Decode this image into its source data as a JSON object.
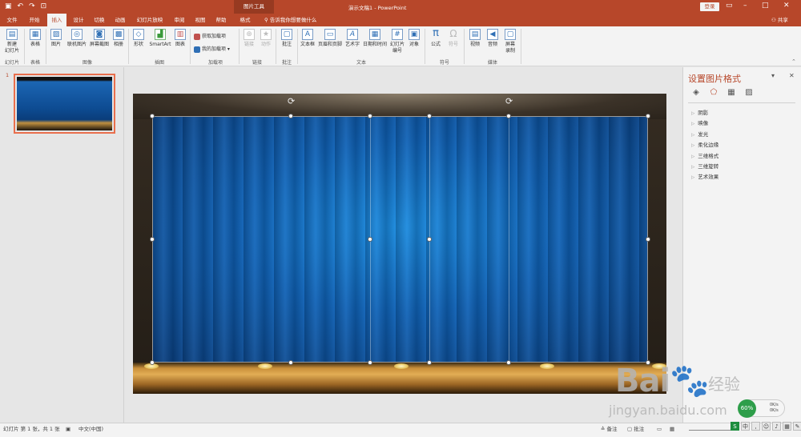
{
  "titlebar": {
    "context_tools": "图片工具",
    "doc_title": "演示文稿1 - PowerPoint",
    "login": "登录",
    "qat": [
      "save-icon",
      "undo-icon",
      "redo-icon",
      "present-icon"
    ]
  },
  "tabs": {
    "items": [
      "文件",
      "开始",
      "插入",
      "设计",
      "切换",
      "动画",
      "幻灯片放映",
      "审阅",
      "视图",
      "帮助",
      "格式"
    ],
    "active": "插入",
    "tell_me": "告诉我你想要做什么",
    "share": "共享"
  },
  "ribbon": {
    "new_slide": "新建\n幻灯片",
    "table": "表格",
    "picture": "图片",
    "online_picture": "联机图片",
    "screenshot": "屏幕截图",
    "album": "相册",
    "shapes": "形状",
    "smartart": "SmartArt",
    "chart": "图表",
    "get_addins": "获取加载项",
    "my_addins": "我的加载项",
    "link": "链接",
    "action": "动作",
    "comment": "批注",
    "textbox": "文本框",
    "header_footer": "页眉和页脚",
    "wordart": "艺术字",
    "datetime": "日期和时间",
    "slide_number": "幻灯片\n编号",
    "object": "对象",
    "equation": "公式",
    "symbol": "符号",
    "video": "视频",
    "audio": "音频",
    "screen_record": "屏幕\n录制",
    "groups": {
      "slides": "幻灯片",
      "tables": "表格",
      "images": "图像",
      "illustrations": "插图",
      "addins": "加载项",
      "links": "链接",
      "comments": "批注",
      "text": "文本",
      "symbols": "符号",
      "media": "媒体"
    }
  },
  "thumbnails": {
    "slide_number": "1"
  },
  "format_pane": {
    "title": "设置图片格式",
    "sections": [
      "阴影",
      "映像",
      "发光",
      "柔化边缘",
      "三维格式",
      "三维旋转",
      "艺术效果"
    ]
  },
  "statusbar": {
    "slide_info": "幻灯片 第 1 张，共 1 张",
    "language": "中文(中国)",
    "notes": "备注",
    "comments": "批注"
  },
  "watermark": {
    "brand": "Bai",
    "brand2": "经验",
    "url": "jingyan.baidu.com"
  },
  "speed_badge": {
    "cpu": "60%",
    "up": "0K/s",
    "down": "0K/s"
  },
  "colors": {
    "accent": "#b7472a",
    "curtain": "#0f62b7",
    "floor": "#c98f3a"
  }
}
